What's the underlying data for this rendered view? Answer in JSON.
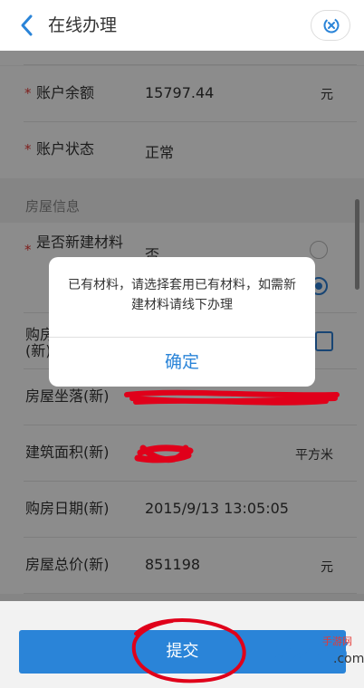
{
  "header": {
    "title": "在线办理"
  },
  "form": {
    "balance": {
      "label": "账户余额",
      "value": "15797.44",
      "unit": "元"
    },
    "status": {
      "label": "账户状态",
      "value": "正常"
    },
    "section": "房屋信息",
    "new_material": {
      "label": "是否新建材料",
      "option_no": "否"
    },
    "purchase_partial": "购房",
    "purchase_partial2": "(新)",
    "location": {
      "label": "房屋坐落(新)"
    },
    "area": {
      "label": "建筑面积(新)",
      "unit": "平方米"
    },
    "date": {
      "label": "购房日期(新)",
      "value": "2015/9/13 13:05:05"
    },
    "price": {
      "label": "房屋总价(新)",
      "value": "851198",
      "unit": "元"
    }
  },
  "dialog": {
    "message": "已有材料，请选择套用已有材料，如需新建材料请线下办理",
    "ok_label": "确定"
  },
  "submit_label": "提交",
  "brand": {
    "logo_text": "2265",
    "suffix": ".com",
    "tag": "手游网"
  },
  "colors": {
    "accent": "#2a84d8",
    "required": "#e53935",
    "scribble": "#e0001a"
  }
}
